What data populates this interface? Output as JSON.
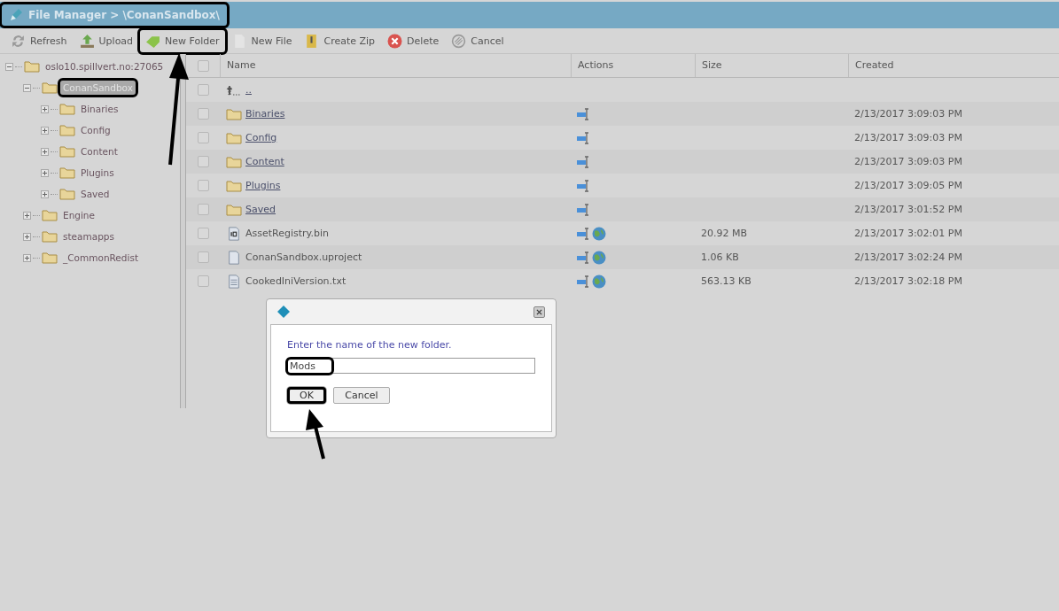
{
  "header": {
    "title": "File Manager > \\ConanSandbox\\",
    "highlighted": true
  },
  "toolbar": [
    {
      "kind": "refresh",
      "label": "Refresh",
      "highlighted": false
    },
    {
      "kind": "upload",
      "label": "Upload",
      "highlighted": false
    },
    {
      "kind": "new-folder",
      "label": "New Folder",
      "highlighted": true
    },
    {
      "kind": "new-file",
      "label": "New File",
      "highlighted": false
    },
    {
      "kind": "zip",
      "label": "Create Zip",
      "highlighted": false
    },
    {
      "kind": "delete",
      "label": "Delete",
      "highlighted": false
    },
    {
      "kind": "cancel",
      "label": "Cancel",
      "highlighted": false
    }
  ],
  "tree": [
    {
      "label": "oslo10.spillvert.no:27065",
      "expanded": true,
      "selected": false,
      "highlighted": false,
      "children": [
        {
          "label": "ConanSandbox",
          "expanded": true,
          "selected": true,
          "highlighted": true,
          "children": [
            {
              "label": "Binaries",
              "expanded": false,
              "selected": false,
              "highlighted": false
            },
            {
              "label": "Config",
              "expanded": false,
              "selected": false,
              "highlighted": false
            },
            {
              "label": "Content",
              "expanded": false,
              "selected": false,
              "highlighted": false
            },
            {
              "label": "Plugins",
              "expanded": false,
              "selected": false,
              "highlighted": false
            },
            {
              "label": "Saved",
              "expanded": false,
              "selected": false,
              "highlighted": false
            }
          ]
        },
        {
          "label": "Engine",
          "expanded": false,
          "selected": false,
          "highlighted": false
        },
        {
          "label": "steamapps",
          "expanded": false,
          "selected": false,
          "highlighted": false
        },
        {
          "label": "_CommonRedist",
          "expanded": false,
          "selected": false,
          "highlighted": false
        }
      ]
    }
  ],
  "table": {
    "all_checked": false,
    "columns": [
      "Name",
      "Actions",
      "Size",
      "Created"
    ],
    "rows": [
      {
        "kind": "up",
        "name": "..",
        "checked": false,
        "web": false
      },
      {
        "kind": "folder",
        "name": "Binaries",
        "checked": false,
        "web": false,
        "created": "2/13/2017 3:09:03 PM"
      },
      {
        "kind": "folder",
        "name": "Config",
        "checked": false,
        "web": false,
        "created": "2/13/2017 3:09:03 PM"
      },
      {
        "kind": "folder",
        "name": "Content",
        "checked": false,
        "web": false,
        "created": "2/13/2017 3:09:03 PM"
      },
      {
        "kind": "folder",
        "name": "Plugins",
        "checked": false,
        "web": false,
        "created": "2/13/2017 3:09:05 PM"
      },
      {
        "kind": "folder",
        "name": "Saved",
        "checked": false,
        "web": false,
        "created": "2/13/2017 3:01:52 PM"
      },
      {
        "kind": "binary",
        "name": "AssetRegistry.bin",
        "checked": false,
        "web": true,
        "size": "20.92 MB",
        "created": "2/13/2017 3:02:01 PM"
      },
      {
        "kind": "file",
        "name": "ConanSandbox.uproject",
        "checked": false,
        "web": true,
        "size": "1.06 KB",
        "created": "2/13/2017 3:02:24 PM"
      },
      {
        "kind": "text",
        "name": "CookedIniVersion.txt",
        "checked": false,
        "web": true,
        "size": "563.13 KB",
        "created": "2/13/2017 3:02:18 PM"
      }
    ]
  },
  "dialog": {
    "message": "Enter the name of the new folder.",
    "value": "Mods",
    "value_highlighted": true,
    "buttons": [
      {
        "label": "OK",
        "highlighted": true
      },
      {
        "label": "Cancel",
        "highlighted": false
      }
    ]
  }
}
